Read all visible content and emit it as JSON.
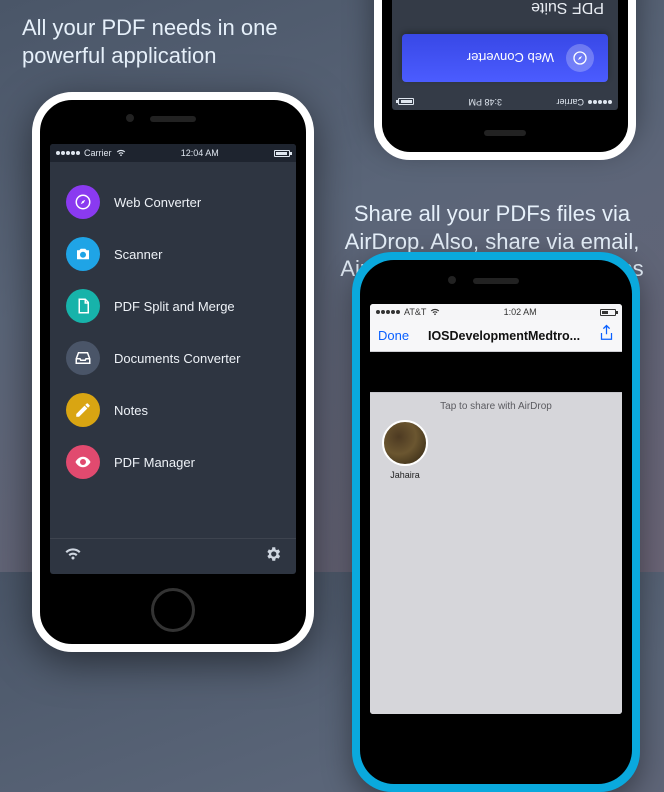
{
  "headline_left": "All your PDF needs in one powerful application",
  "headline_right": "Share all your PDFs files via AirDrop. Also, share via email, AirPrint and open in other apps",
  "phone_left": {
    "status": {
      "carrier": "Carrier",
      "time": "12:04 AM"
    },
    "menu": [
      {
        "label": "Web Converter",
        "icon": "compass-icon",
        "color": "#8a3af0"
      },
      {
        "label": "Scanner",
        "icon": "camera-icon",
        "color": "#1fa4e6"
      },
      {
        "label": "PDF Split and Merge",
        "icon": "document-icon",
        "color": "#17b3aa"
      },
      {
        "label": "Documents Converter",
        "icon": "inbox-icon",
        "color": "#4a5568"
      },
      {
        "label": "Notes",
        "icon": "pencil-icon",
        "color": "#d9a512"
      },
      {
        "label": "PDF Manager",
        "icon": "eye-icon",
        "color": "#e14a6f"
      }
    ]
  },
  "phone_top_right": {
    "status": {
      "carrier": "Carrier",
      "time": "3:48 PM"
    },
    "selected_label": "Web Converter",
    "section_title": "PDF Suite"
  },
  "phone_bottom_right": {
    "status": {
      "carrier": "AT&T",
      "time": "1:02 AM"
    },
    "nav": {
      "done": "Done",
      "title": "IOSDevelopmentMedtro..."
    },
    "sheet": {
      "tap_hint": "Tap to share with AirDrop",
      "contact_name": "Jahaira"
    }
  }
}
